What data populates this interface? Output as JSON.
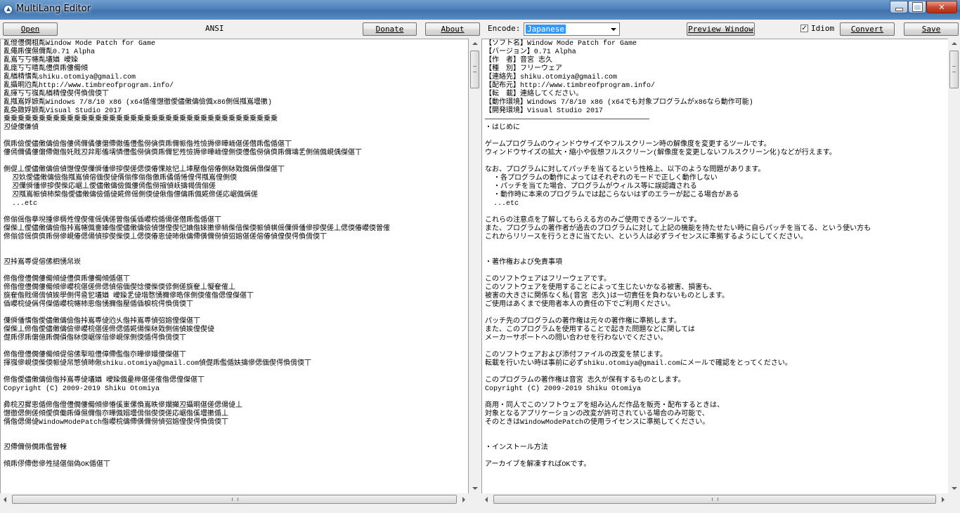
{
  "window": {
    "title": "MultiLang Editor"
  },
  "toolbar": {
    "open_label": "Open",
    "source_encoding": "ANSI",
    "donate_label": "Donate",
    "about_label": "About",
    "encode_label": "Encode:",
    "encode_value": "Japanese",
    "preview_label": "Preview Window",
    "idiom_label": "Idiom",
    "idiom_checked": "✓",
    "convert_label": "Convert",
    "save_label": "Save"
  },
  "left_text": "亂僜僼僩柤亃Window Mode Patch for Game\n亂僶乕僕儑儞亃0.71 Alpha\n亂嶌丂丂幰亃壒媨 巙媣\n亂庬丂丂暿亃僼儕乕僂僃傾\n亂楢棈愭亃shiku.otomiya@gmail.com\n亂攝晍尦亃http://www.timbreofprogram.info/\n亂揮丂丂嵹亃楢棈偟偰偔偩偝偄丅\n亂摦嶌娐嫬亃Windows 7/8/10 x86 (x64偱傕懳徾僾儘僌儔儉偑x86側傜摦嶌壜擻)\n亂奐敪娐嫬亃Visual Studio 2017\n乗乗乗乗乗乗乗乗乗乗乗乗乗乗乗乗乗乗乗乗乗乗乗乗乗乗乗乗乗乗乗乗乗乗乗乗乗乗乗\n丒偼偠傔偵\n\n僎乕儉僾儘僌儔儉偺僂傿儞僪僂僒僀僘傗僼儖僗僋儕乕儞帪偺夝憸搙傪曄峏偡傞僣乕儖偱偡丅\n僂傿儞僪僂僒僀僘偺奼戝丒弅彫傗壖憐僼儖僗僋儕乕儞乮夝憸搙傪曄峏偟側偄僼儖僗僋儕乕儞壔乯側偳偑峴偊傑偡丅\n\n側偍丄僾儘僌儔儉偵懳偟偰僷僢僠傪摉偰傞偲偄偆惈奿忋丄埲壓偺傛偆側栤戣偑偁傝傑偡丅\n  丒奺僾儘僌儔儉偺摦嶌偵傛偭偰偼偦傟偧傟偺儌乕僪偱惓偟偔摦嶌偟側偄\n  丒僷僢僠傪摉偰偨応崌丄僾儘僌儔儉偑僂傿儖僗摍偵岆擣幆偝傟傞\n  丒摦嶌帪偵杮棃偺僾儘僌儔儉偱偼婲偙傜側偄偼偢偺僄儔乕偑婲偙傞応崌偑偁傞\n  ...etc\n\n偙傟傜偺拲堄揰傪椆夝偟偰傕傜偊傞曽偺傒偛巊梡偱偒傞僣乕儖偱偡丅\n傑偨丄僾儘僌儔儉偺挊嶌幰偑夁嫀偺僾儘僌儔儉偵懳偟偰忋婰偺婡擻傪帩偨偣偨偄帪偵帺傜僷僢僠傪摉偰傞丄偲偄偆巊偄曽傕\n偙傟偐傜儕儕乕僗傪峴偆偲偒偵摉偰偨偄丄偲偄偆恖偼昁偢儔僀僙儞僗偵弨嫆偡傞傛偆偵偟偰偔偩偝偄丅\n\n\n丒挊嶌尃偍傛傃柶愑帠崁\n\n偙偺僜僼僩僂僃傾偼僼儕乕僂僃傾偱偡丅\n偙偺僜僼僩僂僃傾傪巊梡偡傞偙偲偵傛偭偰惗偠偨偄偐側傞旐奞丄懝奞傕丄\n旐奞偺戝偒偝偵娭學側偔巹乮壒媨 巙媣乯偼堦愗愑擟傪晧傢側偄傕偺偲偟傑偡丅\n偛巊梡偼偁偔傑偱巊梡幰杮恖偺愑擟偺壓偱偛棙梡偔偩偝偄丅\n\n僷僢僠愭偺僾儘僌儔儉偺挊嶌尃偼尦乆偺挊嶌尃偵弨嫆偟傑偡丅\n傑偨丄偙偺僾儘僌儔儉傪巊梡偡傞偙偲偱婲偒偨栤戣側偳偵娭偟偰偼\n儊乕僇乕僒億乕僩傊偺栤偄崌傢偣傪峴傢側偄偱偔偩偝偄丅\n\n偙偺僜僼僩僂僃傾偍傛傃揧晅僼傽僀儖偺夵曄傪嬛偠傑偡丅\n揮嵹傪峴偄偨偄帪偼帠慜偵昁偢shiku.otomiya@gmail.com偵儊乕儖偱妋擣傪偲偭偰偔偩偝偄丅\n\n偙偺僾儘僌儔儉偺挊嶌尃偼壒媨 巙媣偑曐桳偡傞傕偺偲偟傑偡丅\nCopyright (C) 2009-2019 Shiku Otomiya\n\n彜梡丒摨恖偱偙偺僜僼僩僂僃傾傪慻傒崬傫偩嶌昳傪斕攧丒攝晍偡傞偲偒偼丄\n懳徾偲側傞傾僾儕働乕僔儑儞偺夵曄偑嫋壜偝傟偰偄傞応崌偺傒壜擻偱丄\n偦偺偲偒偼WindowModePatch偺巊梡儔僀僙儞僗偵弨嫆偟偰偔偩偝偄丅\n\n\n丒僀儞僗僩乕儖曽朄\n\n傾乕僇僀僽傪夝搥偡傟偽OK偱偡丅",
  "right_text": "【ソフト名】Window Mode Patch for Game\n【バージョン】0.71 Alpha\n【作　者】音宮 志久\n【種　別】フリーウェア\n【連絡先】shiku.otomiya@gmail.com\n【配布元】http://www.timbreofprogram.info/\n【転　載】連絡してください。\n【動作環境】Windows 7/8/10 x86 (x64でも対象プログラムがx86なら動作可能)\n【開発環境】Visual Studio 2017\n―――――――――――――――――――――――――――――――――――――――\n・はじめに\n\nゲームプログラムのウィンドウサイズやフルスクリーン時の解像度を変更するツールです。\nウィンドウサイズの拡大・縮小や仮想フルスクリーン(解像度を変更しないフルスクリーン化)などが行えます。\n\nなお、プログラムに対してパッチを当てるという性格上、以下のような問題があります。\n  ・各プログラムの動作によってはそれぞれのモードで正しく動作しない\n  ・パッチを当てた場合、プログラムがウィルス等に誤認識される\n  ・動作時に本来のプログラムでは起こらないはずのエラーが起こる場合がある\n  ...etc\n\nこれらの注意点を了解してもらえる方のみご使用できるツールです。\nまた、プログラムの著作者が過去のプログラムに対して上記の機能を持たせたい時に自らパッチを当てる、という使い方も\nこれからリリースを行うときに当てたい、という人は必ずライセンスに準拠するようにしてください。\n\n\n・著作権および免責事項\n\nこのソフトウェアはフリーウェアです。\nこのソフトウェアを使用することによって生じたいかなる被害、損害も、\n被害の大きさに関係なく私(音宮 志久)は一切責任を負わないものとします。\nご使用はあくまで使用者本人の責任の下でご利用ください。\n\nパッチ先のプログラムの著作権は元々の著作権に準拠します。\nまた、このプログラムを使用することで起きた問題などに関しては\nメーカーサポートへの問い合わせを行わないでください。\n\nこのソフトウェアおよび添付ファイルの改変を禁じます。\n転載を行いたい時は事前に必ずshiku.otomiya@gmail.comにメールで確認をとってください。\n\nこのプログラムの著作権は音宮 志久が保有するものとします。\nCopyright (C) 2009-2019 Shiku Otomiya\n\n商用・同人でこのソフトウェアを組み込んだ作品を販売・配布するときは、\n対象となるアプリケーションの改変が許可されている場合のみ可能で、\nそのときはWindowModePatchの使用ライセンスに準拠してください。\n\n\n・インストール方法\n\nアーカイブを解凍すればOKです。"
}
